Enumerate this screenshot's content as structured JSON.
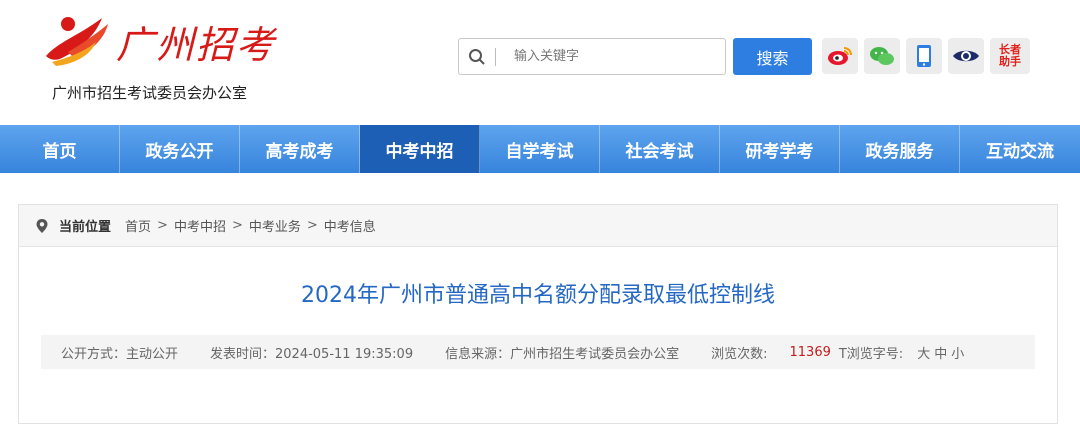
{
  "header": {
    "logo_text": "广州招考",
    "subtitle": "广州市招生考试委员会办公室"
  },
  "search": {
    "placeholder": "输入关键字",
    "button_label": "搜索"
  },
  "social": {
    "icons": [
      "weibo-icon",
      "wechat-icon",
      "mobile-icon",
      "eye-icon"
    ],
    "elder_line1": "长者",
    "elder_line2": "助手"
  },
  "nav": {
    "items": [
      "首页",
      "政务公开",
      "高考成考",
      "中考中招",
      "自学考试",
      "社会考试",
      "研考学考",
      "政务服务",
      "互动交流"
    ],
    "active_index": 3
  },
  "breadcrumb": {
    "label": "当前位置",
    "items": [
      "首页",
      "中考中招",
      "中考业务",
      "中考信息"
    ],
    "separator": ">"
  },
  "article": {
    "title": "2024年广州市普通高中名额分配录取最低控制线",
    "disclosure": "公开方式：主动公开",
    "published": "发表时间：2024-05-11 19:35:09",
    "source": "信息来源：广州市招生考试委员会办公室",
    "views_label": "浏览次数:",
    "views_count": "11369",
    "font_label": "T浏览字号:",
    "font_sizes": [
      "大",
      "中",
      "小"
    ]
  },
  "colors": {
    "brand_red": "#d71a18",
    "nav_blue": "#3784dc",
    "nav_active": "#1d5fb5",
    "title_blue": "#2568c4",
    "count_red": "#c31d1d"
  }
}
